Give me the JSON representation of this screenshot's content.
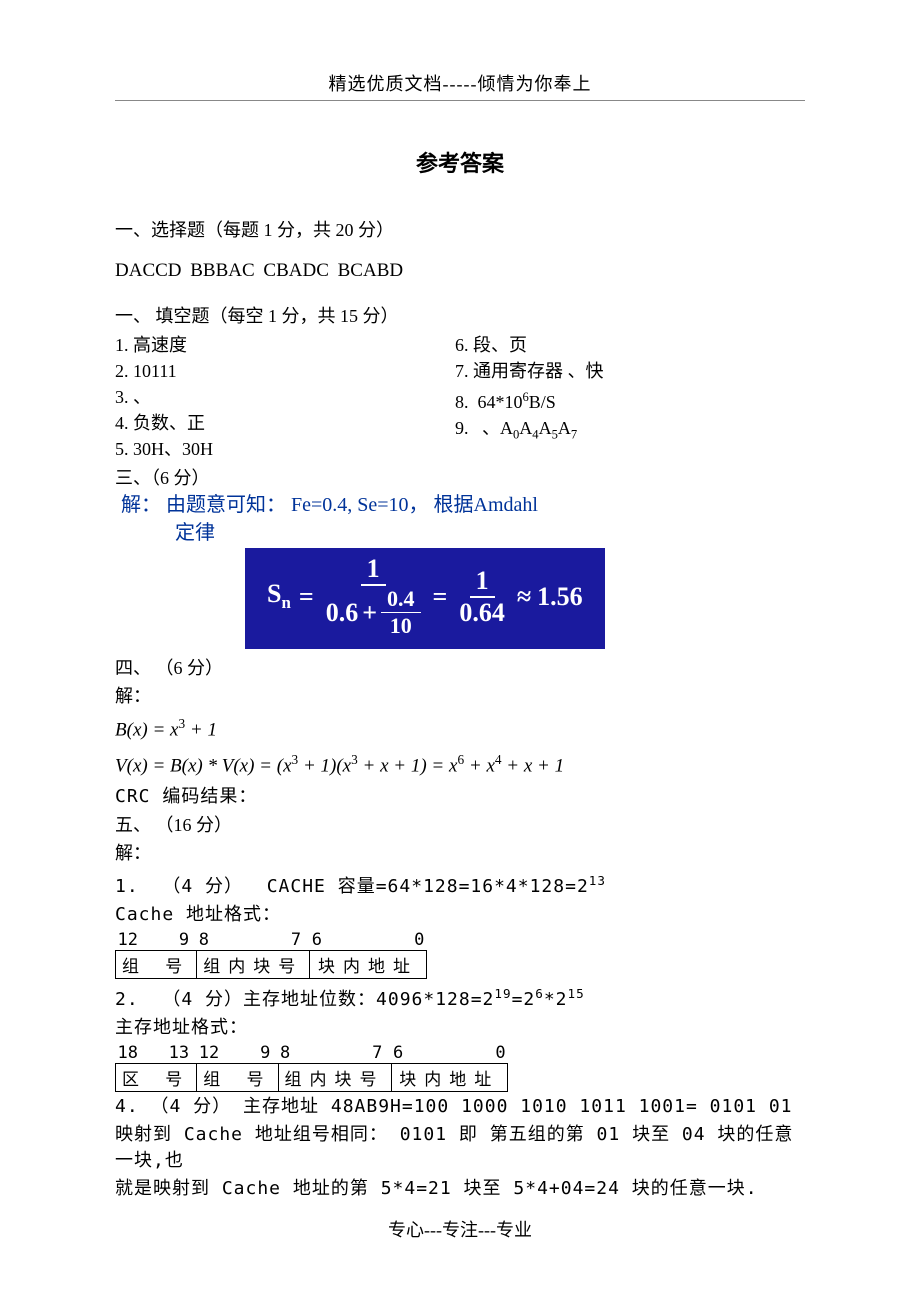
{
  "header": "精选优质文档-----倾情为你奉上",
  "title": "参考答案",
  "sec1": {
    "head": "一、选择题（每题 1 分，共 20 分）",
    "answers": "DACCD   BBBAC    CBADC    BCABD"
  },
  "sec2": {
    "head": "一、   填空题（每空 1 分，共 15 分）",
    "left": [
      "1.  高速度",
      "2.  10111",
      "3.  、",
      "4.  负数、正",
      "5.  30H、30H"
    ],
    "right": [
      "6.  段、页",
      "7.  通用寄存器 、快",
      "8.  64*10⁶B/S",
      "9.   、A₀A₄A₅A₇"
    ]
  },
  "sec3": {
    "head": "三、（6 分）",
    "blue_l1": "解：  由题意可知：  Fe=0.4, Se=10，  根据Amdahl",
    "blue_l2": "定律",
    "formula": {
      "lhs": "S",
      "sub": "n",
      "num1": "1",
      "den1_a": "0.6",
      "den1_frac_top": "0.4",
      "den1_frac_bot": "10",
      "num2": "1",
      "den2": "0.64",
      "approx": "1.56"
    }
  },
  "sec4": {
    "head": "四、 （6 分）",
    "jie": "解：",
    "m1": "B(x) = x³ + 1",
    "m2": "V(x) = B(x) * V(x) = (x³ + 1)(x³ + x + 1) = x⁶ + x⁴ + x + 1",
    "crc": "CRC 编码结果："
  },
  "sec5": {
    "head": "五、 （16 分）",
    "jie": "解：",
    "l1": "1.  （4 分）  CACHE 容量=64*128=16*4*128=2¹³",
    "l2": "Cache 地址格式：",
    "t1_hdr": [
      "12    9",
      "8        7",
      "6         0"
    ],
    "t1_row": [
      "组 号",
      "组内块号",
      "块内地址"
    ],
    "l3": "2.  （4 分）主存地址位数：4096*128=2¹⁹=2⁶*2¹⁵",
    "l4": "主存地址格式：",
    "t2_hdr": [
      "18   13",
      "12    9",
      "8        7",
      "6         0"
    ],
    "t2_row": [
      "区 号",
      "组 号",
      "组内块号",
      "块内地址"
    ],
    "l5": "4.  （4 分）  主存地址 48AB9H=100 1000 1010 1011 1001= 0101 01",
    "l6": "映射到 Cache 地址组号相同：  0101 即 第五组的第 01 块至 04 块的任意一块,也",
    "l7": "就是映射到 Cache 地址的第 5*4=21 块至 5*4+04=24 块的任意一块."
  },
  "footer": "专心---专注---专业"
}
